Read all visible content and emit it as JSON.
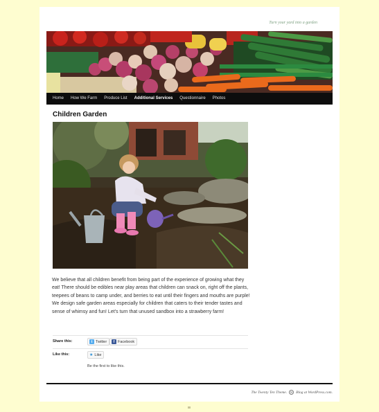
{
  "site": {
    "tagline": "Turn your yard into a garden"
  },
  "nav": {
    "items": [
      {
        "label": "Home",
        "active": false
      },
      {
        "label": "How We Farm",
        "active": false
      },
      {
        "label": "Produce List",
        "active": false
      },
      {
        "label": "Additional Services",
        "active": true
      },
      {
        "label": "Questionnaire",
        "active": false
      },
      {
        "label": "Photos",
        "active": false
      }
    ]
  },
  "post": {
    "title": "Children Garden",
    "body": "We believe that all children benefit from being part of the experience of growing what they eat! There should be edibles near play areas that children can snack on, right off  the plants, teepees of beans to camp under, and berries to eat until their fingers and mouths are purple!  We design safe garden areas especially for children that caters to their tender tastes and sense of whimsy and fun!  Let’s turn that unused sandbox into a strawberry farm!"
  },
  "sharing": {
    "share_label": "Share this:",
    "twitter_label": "Twitter",
    "facebook_label": "Facebook",
    "like_label": "Like this:",
    "like_button": "Like",
    "like_note": "Be the first to like this."
  },
  "footer": {
    "theme_credit": "The Twenty Ten Theme.",
    "wp_credit": "Blog at WordPress.com."
  },
  "colors": {
    "background": "#fefdd0",
    "nav_bar": "#0d0d0d",
    "tagline": "#7a9e7e"
  }
}
